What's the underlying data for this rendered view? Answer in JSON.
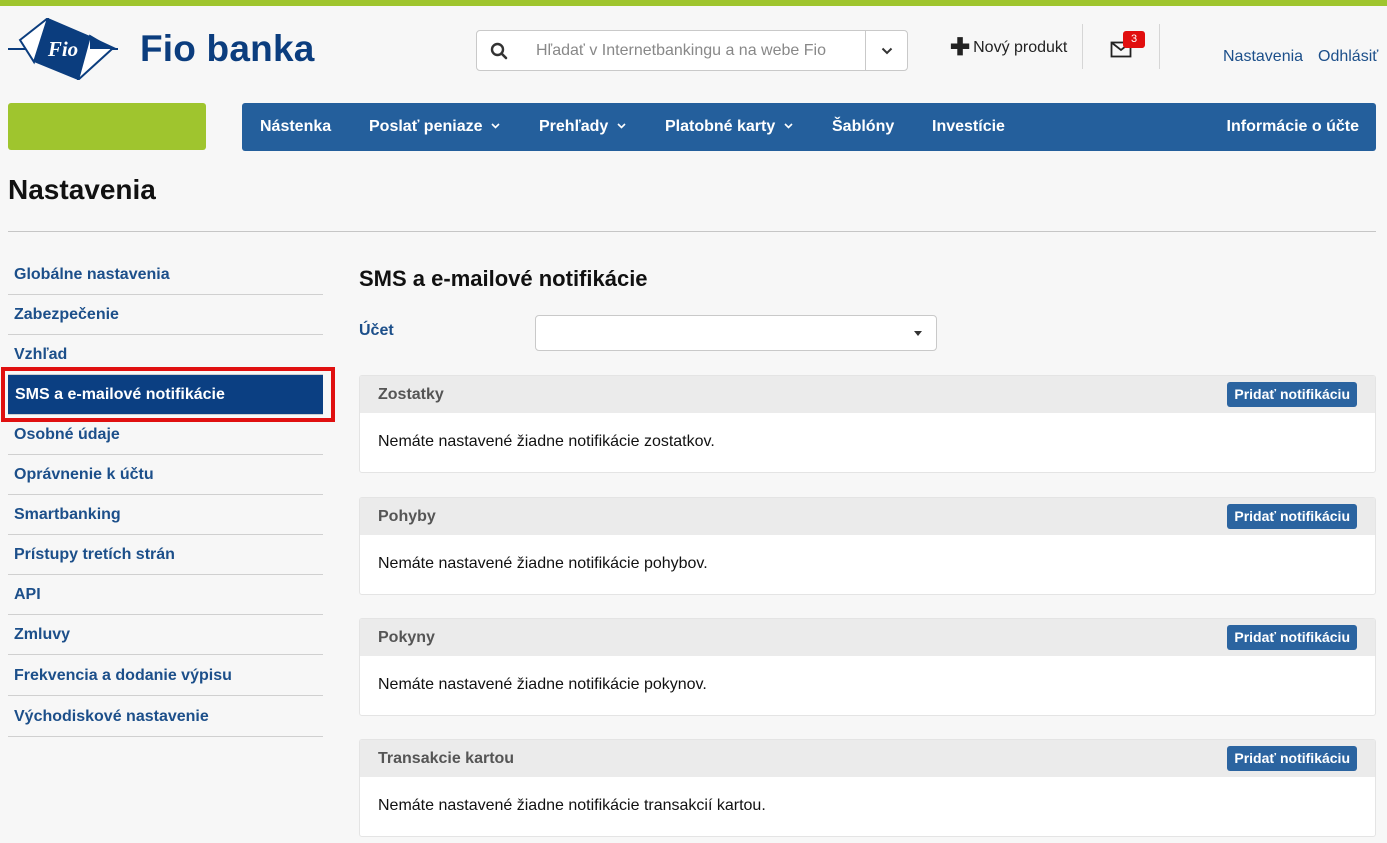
{
  "brand": {
    "name": "Fio banka",
    "logo_mark": "Fio"
  },
  "header": {
    "search_placeholder": "Hľadať v Internetbankingu a na webe Fio",
    "new_product": "Nový produkt",
    "mail_count": "3",
    "settings_link": "Nastavenia",
    "logout_link": "Odhlásiť"
  },
  "nav": {
    "items": [
      "Nástenka",
      "Poslať peniaze",
      "Prehľady",
      "Platobné karty",
      "Šablóny",
      "Investície"
    ],
    "right_item": "Informácie o účte"
  },
  "page": {
    "title": "Nastavenia"
  },
  "sidebar": {
    "items": [
      "Globálne nastavenia",
      "Zabezpečenie",
      "Vzhľad",
      "SMS a e-mailové notifikácie",
      "Osobné údaje",
      "Oprávnenie k účtu",
      "Smartbanking",
      "Prístupy tretích strán",
      "API",
      "Zmluvy",
      "Frekvencia a dodanie výpisu",
      "Východiskové nastavenie"
    ],
    "active": "SMS a e-mailové notifikácie"
  },
  "content": {
    "title": "SMS a e-mailové notifikácie",
    "account_label": "Účet",
    "account_value": "",
    "add_button": "Pridať notifikáciu",
    "panels": [
      {
        "title": "Zostatky",
        "empty_text": "Nemáte nastavené žiadne notifikácie zostatkov."
      },
      {
        "title": "Pohyby",
        "empty_text": "Nemáte nastavené žiadne notifikácie pohybov."
      },
      {
        "title": "Pokyny",
        "empty_text": "Nemáte nastavené žiadne notifikácie pokynov."
      },
      {
        "title": "Transakcie kartou",
        "empty_text": "Nemáte nastavené žiadne notifikácie transakcií kartou."
      }
    ]
  },
  "colors": {
    "brand_green": "#9fc52e",
    "nav_blue": "#245f9c",
    "active_blue": "#0b3f82",
    "link_blue": "#1c4f8a",
    "highlight_red": "#e01010"
  }
}
